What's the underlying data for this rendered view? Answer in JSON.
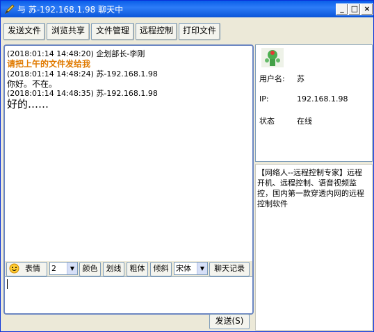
{
  "window": {
    "title": "与 苏-192.168.1.98 聊天中",
    "minimize": "_",
    "maximize": "□",
    "close": "×"
  },
  "toolbar": {
    "buttons": [
      "发送文件",
      "浏览共享",
      "文件管理",
      "远程控制",
      "打印文件"
    ]
  },
  "chat": {
    "messages": [
      {
        "header": "(2018:01:14 14:48:20)  企划部长-李刚",
        "text": "请把上午的文件发给我",
        "text_color": "#e07a00"
      },
      {
        "header": "(2018:01:14 14:48:24)  苏-192.168.1.98",
        "text": "你好。不在。",
        "text_color": "#000000"
      },
      {
        "header": "(2018:01:14 14:48:35)  苏-192.168.1.98",
        "text": "好的……",
        "text_color": "#000000"
      }
    ]
  },
  "format_bar": {
    "emoji_label": "表情",
    "size_value": "2",
    "color_label": "颜色",
    "underline_label": "划线",
    "bold_label": "粗体",
    "italic_label": "倾斜",
    "font_value": "宋体",
    "history_label": "聊天记录"
  },
  "input": {
    "value": ""
  },
  "send": {
    "label": "发送(S)"
  },
  "contact": {
    "username_label": "用户名:",
    "username_value": "苏",
    "ip_label": "IP:",
    "ip_value": "192.168.1.98",
    "status_label": "状态",
    "status_value": "在线"
  },
  "ad": {
    "text": "【网络人--远程控制专家】远程开机、远程控制、语音视频监控，国内第一款穿透内网的远程控制软件"
  },
  "colors": {
    "title_bar": "#0a5ee8",
    "accent_border": "#6b86c2",
    "highlight_text": "#e07a00"
  }
}
